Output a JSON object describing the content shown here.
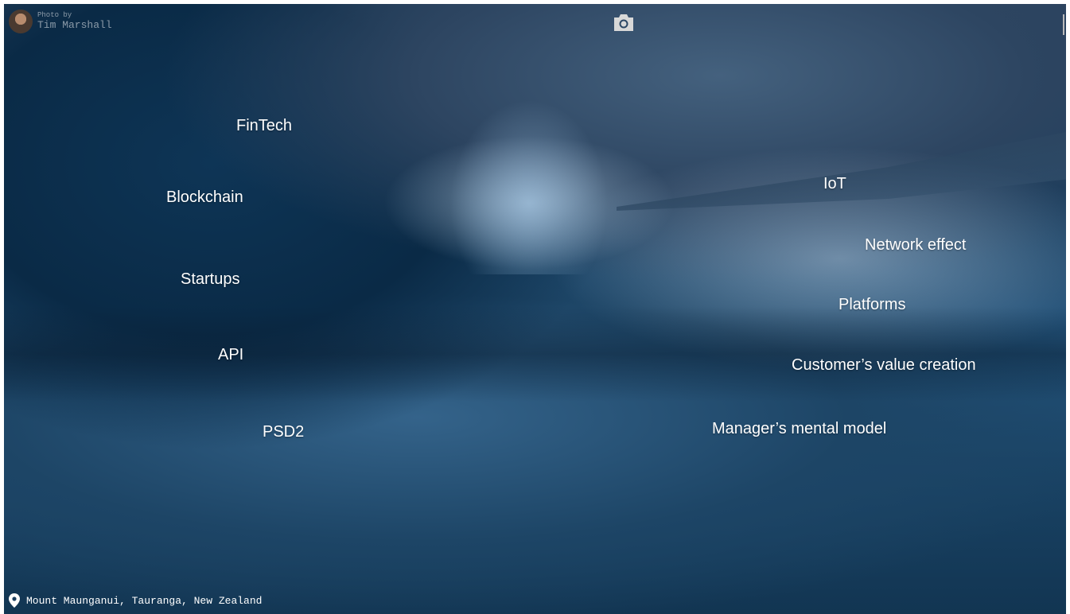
{
  "photo_credit": {
    "prefix": "Photo by",
    "author": "Tim Marshall"
  },
  "camera_icon": "camera-icon",
  "location": {
    "icon": "map-pin-icon",
    "text": "Mount Maunganui, Tauranga, New Zealand"
  },
  "keywords_left": [
    "FinTech",
    "Blockchain",
    "Startups",
    "API",
    "PSD2"
  ],
  "keywords_right": [
    "IoT",
    "Network effect",
    "Platforms",
    "Customer’s value creation",
    "Manager’s mental model"
  ],
  "colors": {
    "text": "#ffffff",
    "ocean_dark": "#0a2a46",
    "ocean_mid": "#24557d",
    "sky": "#44617e"
  }
}
